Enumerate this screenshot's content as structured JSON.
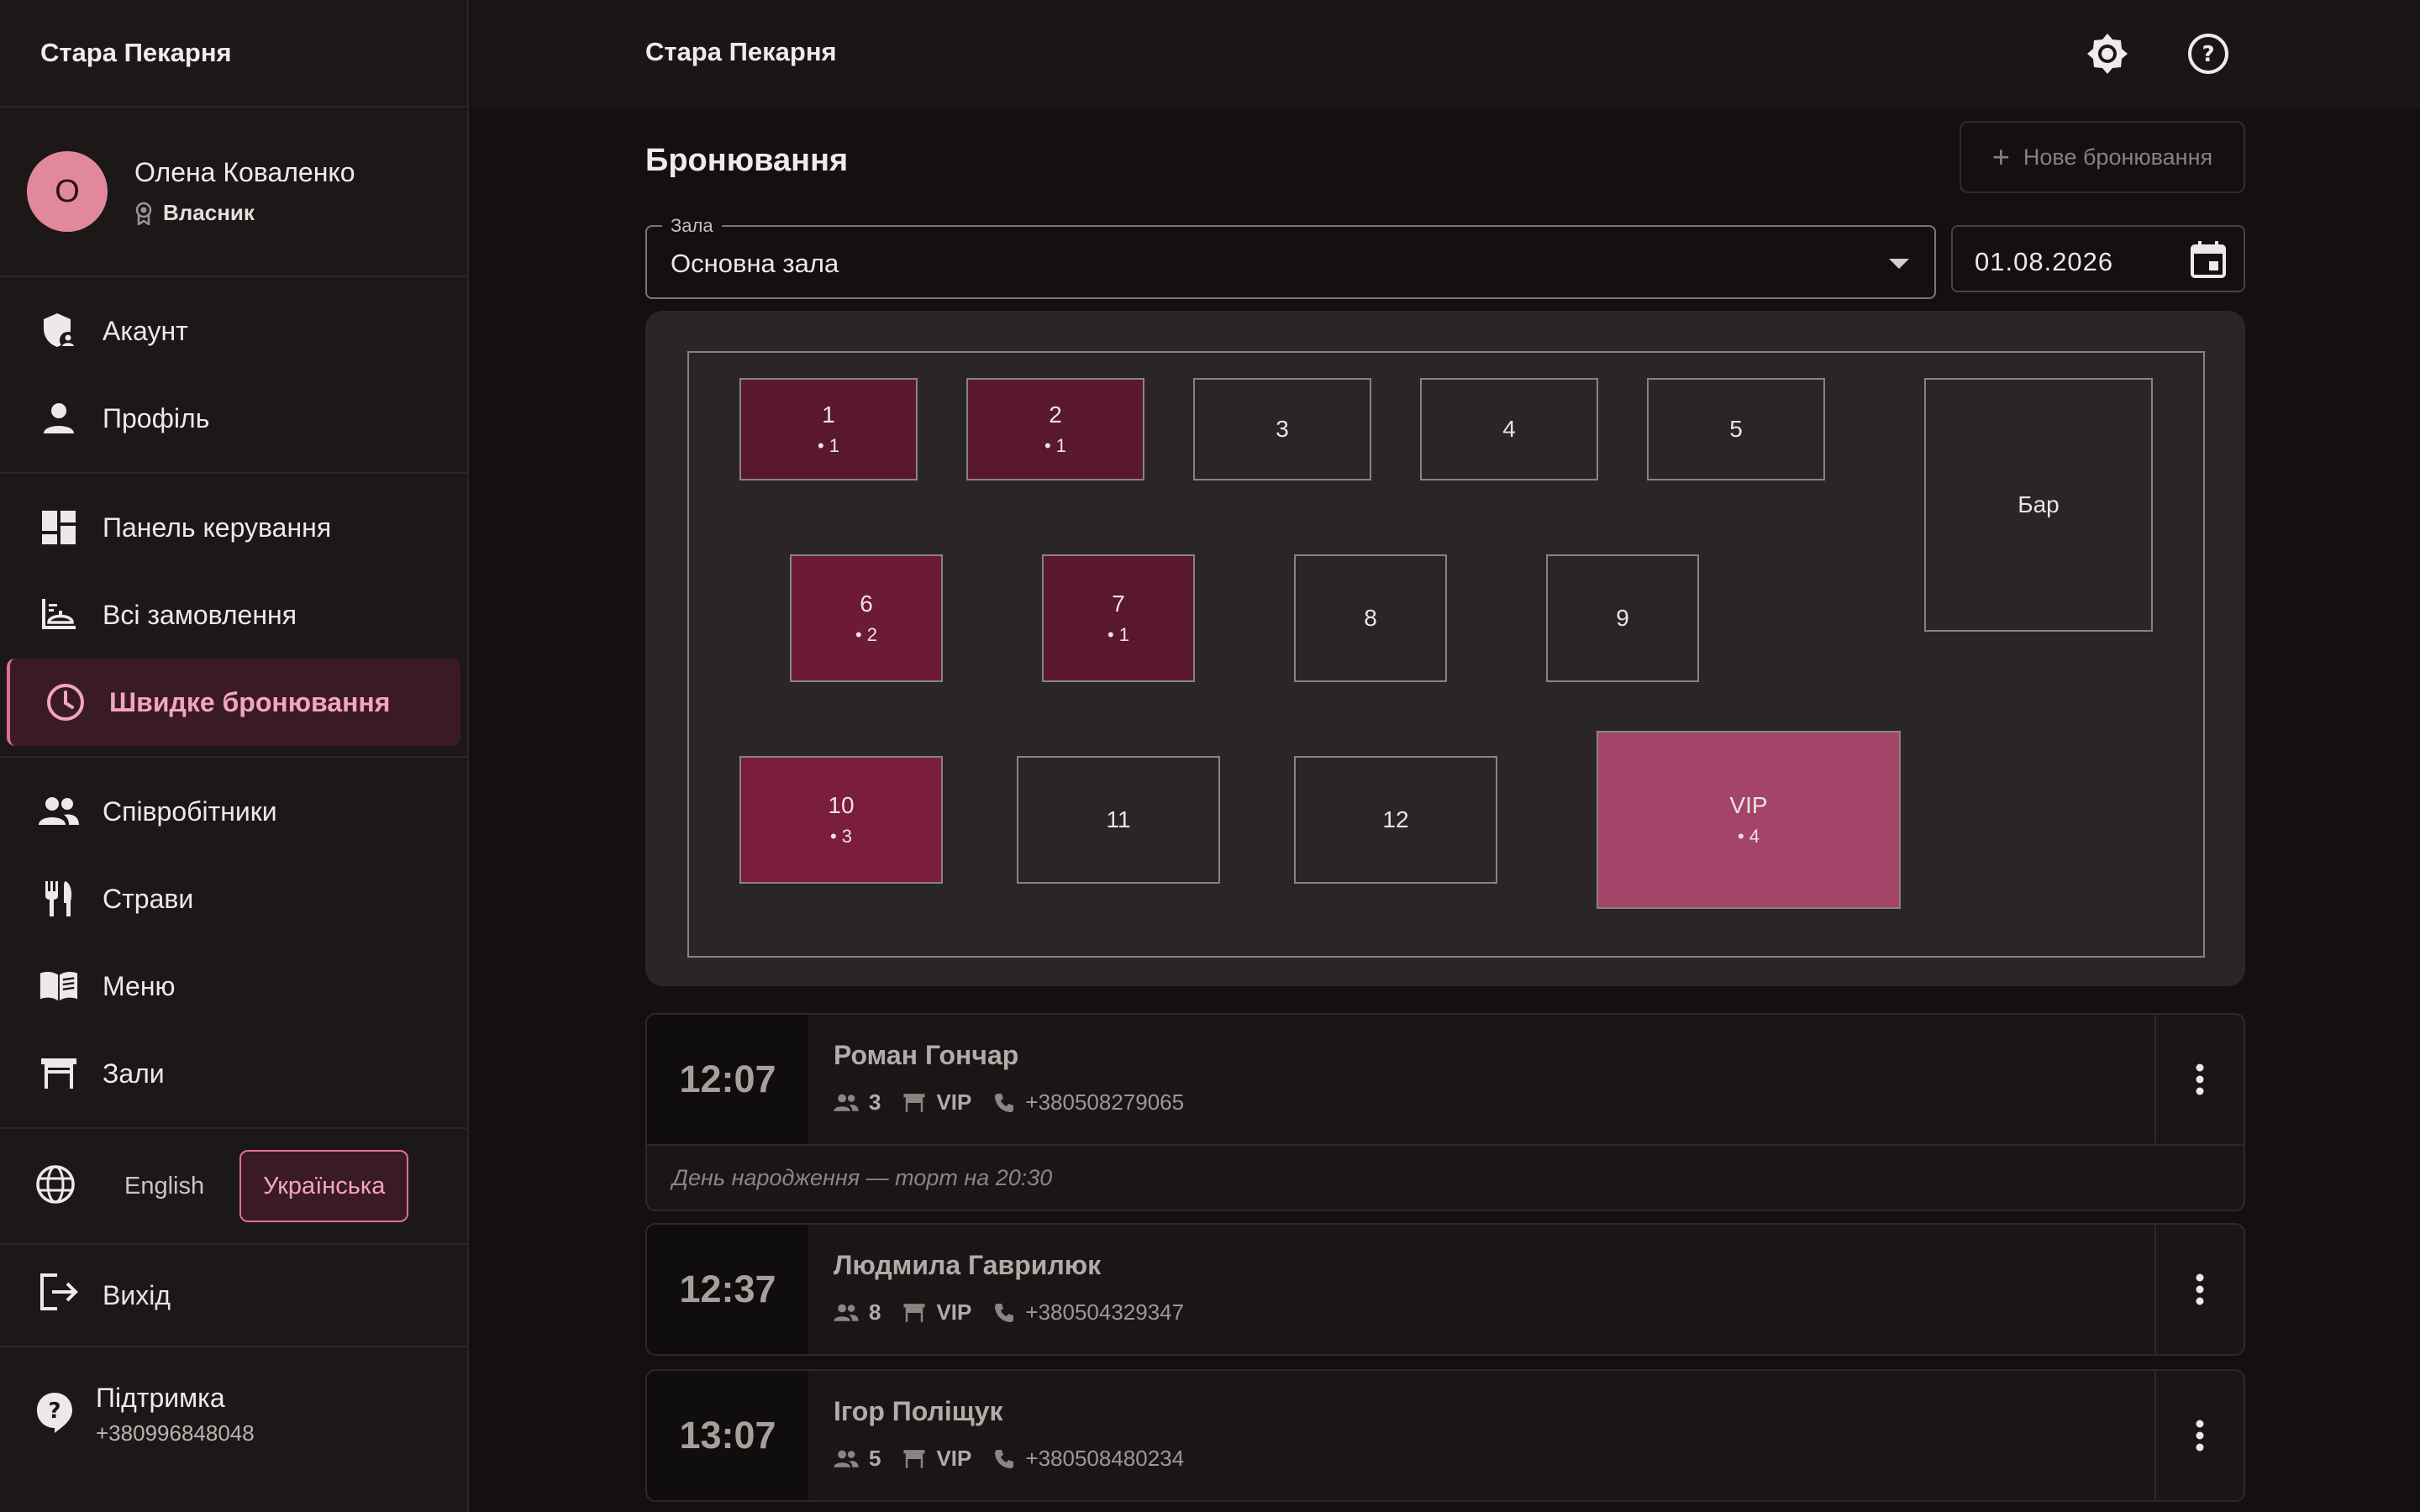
{
  "app": {
    "brand": "Стара Пекарня",
    "topbar_title": "Стара Пекарня"
  },
  "user": {
    "initial": "О",
    "name": "Олена Коваленко",
    "role": "Власник"
  },
  "nav": {
    "account": "Акаунт",
    "profile": "Профіль",
    "dashboard": "Панель керування",
    "orders": "Всі замовлення",
    "quick_booking": "Швидке бронювання",
    "staff": "Співробітники",
    "dishes": "Страви",
    "menu": "Меню",
    "halls": "Зали"
  },
  "languages": {
    "english": "English",
    "ukrainian": "Українська",
    "selected": "Українська"
  },
  "logout": "Вихід",
  "support": {
    "title": "Підтримка",
    "phone": "+380996848048"
  },
  "page": {
    "title": "Бронювання",
    "new_button": "Нове бронювання"
  },
  "filters": {
    "hall_label": "Зала",
    "hall_value": "Основна зала",
    "date": "01.08.2026"
  },
  "tables": [
    {
      "label": "1",
      "count": "1"
    },
    {
      "label": "2",
      "count": "1"
    },
    {
      "label": "3",
      "count": ""
    },
    {
      "label": "4",
      "count": ""
    },
    {
      "label": "5",
      "count": ""
    },
    {
      "label": "Бар",
      "count": ""
    },
    {
      "label": "6",
      "count": "2"
    },
    {
      "label": "7",
      "count": "1"
    },
    {
      "label": "8",
      "count": ""
    },
    {
      "label": "9",
      "count": ""
    },
    {
      "label": "10",
      "count": "3"
    },
    {
      "label": "11",
      "count": ""
    },
    {
      "label": "12",
      "count": ""
    },
    {
      "label": "VIP",
      "count": "4"
    }
  ],
  "reservations": [
    {
      "time": "12:07",
      "name": "Роман Гончар",
      "guests": "3",
      "table": "VIP",
      "phone": "+380508279065",
      "note": "День народження — торт на 20:30"
    },
    {
      "time": "12:37",
      "name": "Людмила Гаврилюк",
      "guests": "8",
      "table": "VIP",
      "phone": "+380504329347"
    },
    {
      "time": "13:07",
      "name": "Ігор Поліщук",
      "guests": "5",
      "table": "VIP",
      "phone": "+380508480234"
    }
  ],
  "colors": {
    "accent": "#e0718f",
    "background": "#141010",
    "sidebar": "#1c1818",
    "vip_table": "#a34468",
    "booked_table": "#5a1830"
  }
}
